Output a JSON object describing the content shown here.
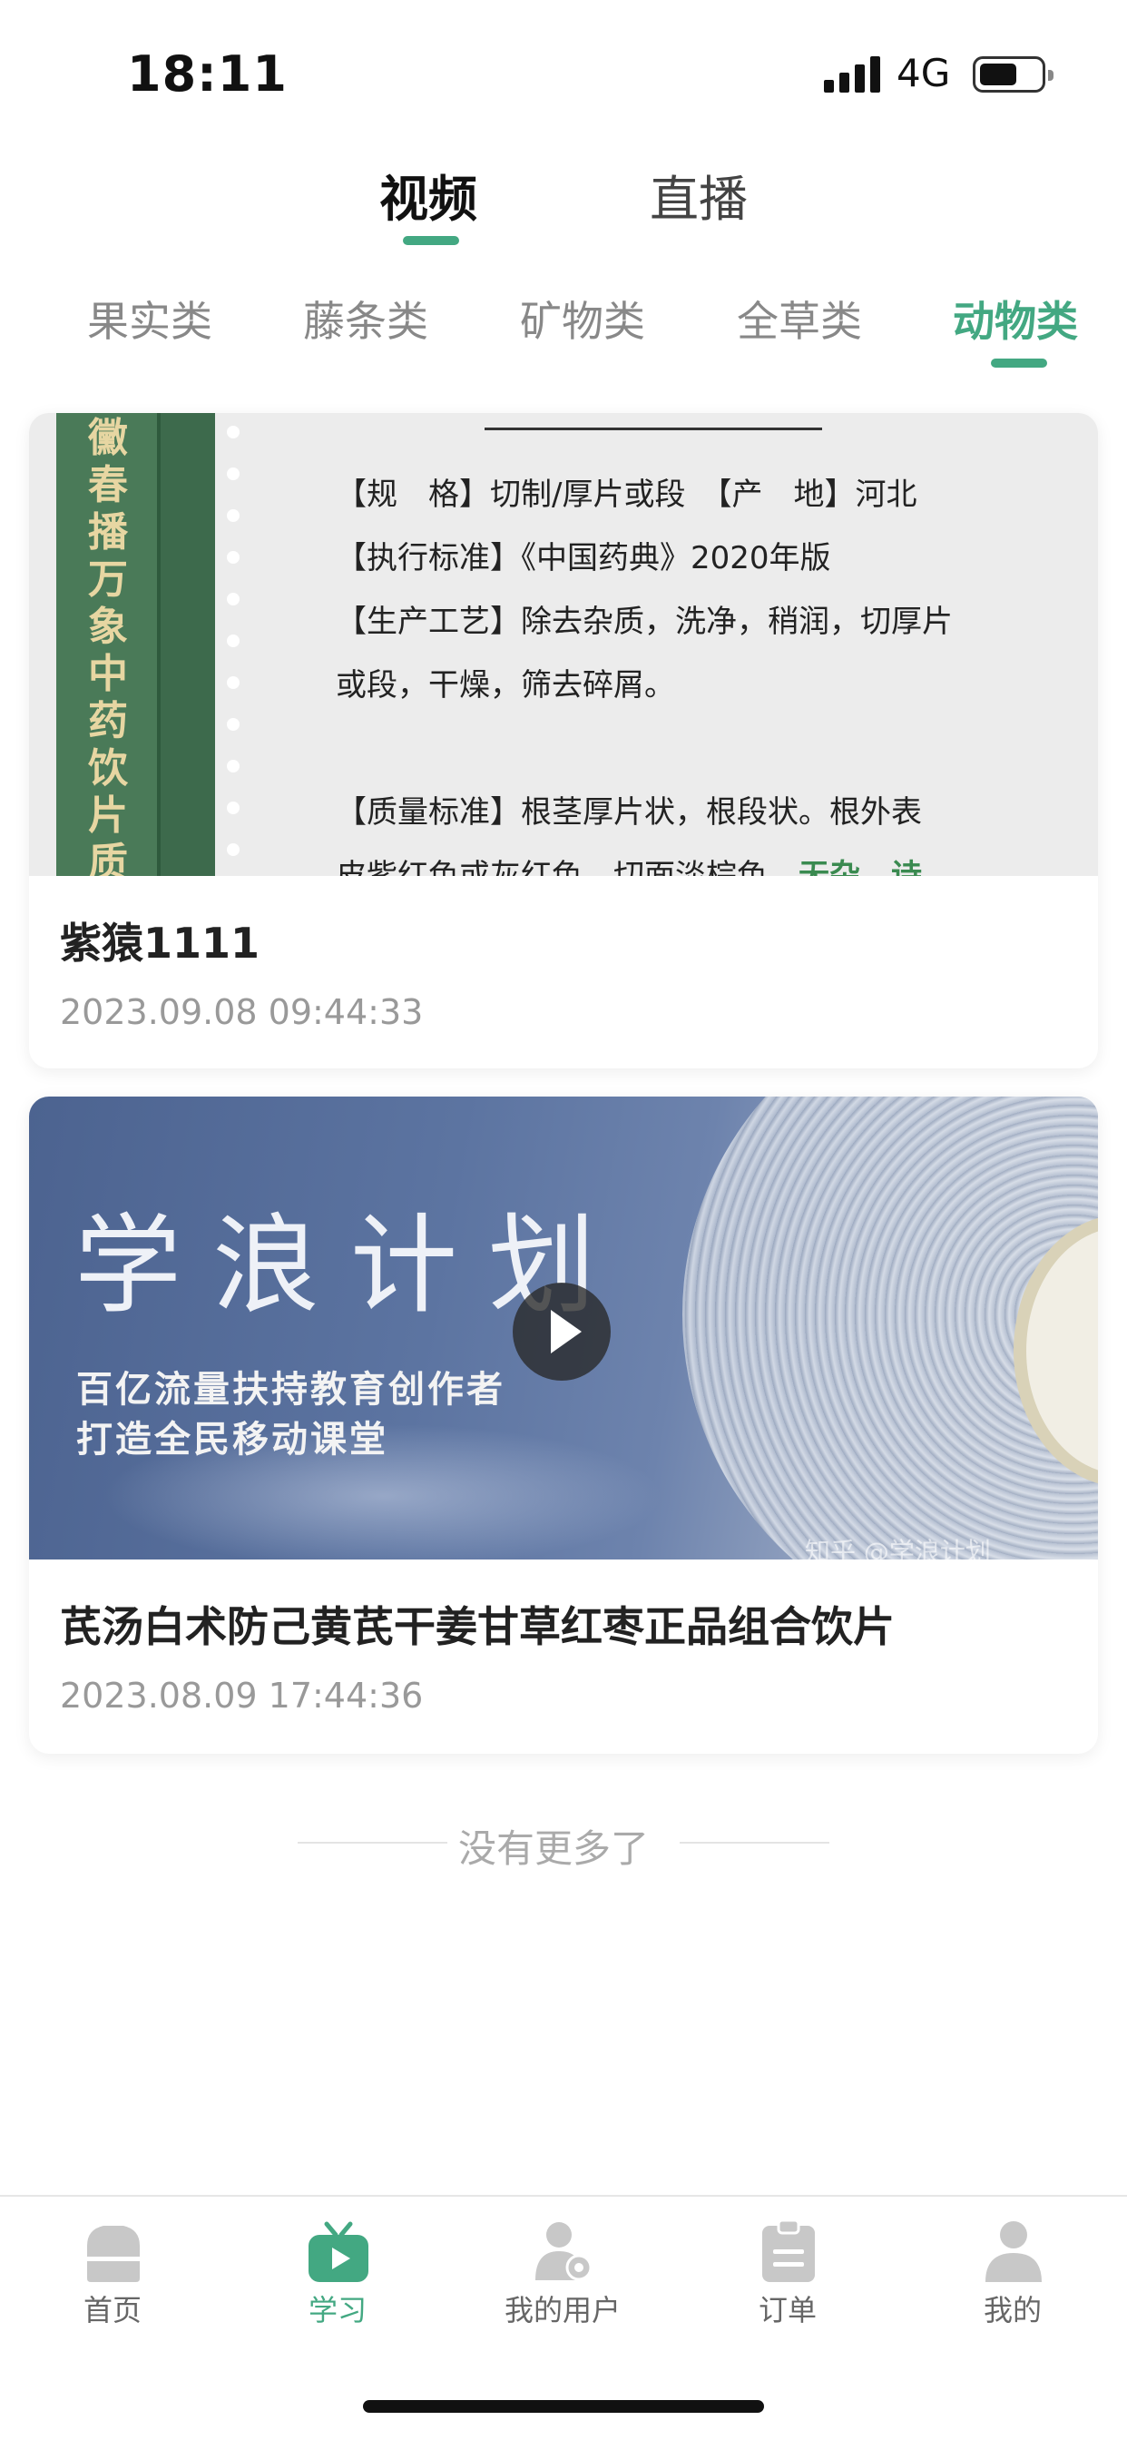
{
  "status_bar": {
    "time": "18:11",
    "network": "4G"
  },
  "main_tabs": [
    {
      "label": "视频",
      "active": true
    },
    {
      "label": "直播",
      "active": false
    }
  ],
  "category_tabs": [
    {
      "label": "果实类",
      "active": false
    },
    {
      "label": "藤条类",
      "active": false
    },
    {
      "label": "矿物类",
      "active": false
    },
    {
      "label": "全草类",
      "active": false
    },
    {
      "label": "动物类",
      "active": true
    }
  ],
  "cards": [
    {
      "title": "紫猿1111",
      "date": "2023.09.08 09:44:33",
      "thumb": {
        "vertical_text": "黴春播万象中药饮片质",
        "lines": [
          "【规　格】切制/厚片或段　【产　地】河北",
          "【执行标准】《中国药典》2020年版",
          "【生产工艺】除去杂质，洗净，稍润，切厚片",
          "或段，干燥，筛去碎屑。",
          "",
          "【质量标准】根茎厚片状，根段状。根外表",
          "皮紫红色或灰红色，切面淡棕色，"
        ],
        "green_tail": "无杂、诗"
      }
    },
    {
      "title": "芪汤白术防己黄芪干姜甘草红枣正品组合饮片",
      "date": "2023.08.09 17:44:36",
      "thumb": {
        "title": "学浪计划",
        "subtitle_1": "百亿流量扶持教育创作者",
        "subtitle_2": "打造全民移动课堂",
        "watermark": "知乎 @学浪计划"
      }
    }
  ],
  "no_more": "没有更多了",
  "tab_bar": [
    {
      "label": "首页",
      "icon": "home-icon",
      "active": false
    },
    {
      "label": "学习",
      "icon": "tv-play-icon",
      "active": true
    },
    {
      "label": "我的用户",
      "icon": "user-gear-icon",
      "active": false
    },
    {
      "label": "订单",
      "icon": "clipboard-icon",
      "active": false
    },
    {
      "label": "我的",
      "icon": "person-icon",
      "active": false
    }
  ],
  "colors": {
    "accent": "#43a882",
    "inactive_icon": "#c8c8c8"
  }
}
